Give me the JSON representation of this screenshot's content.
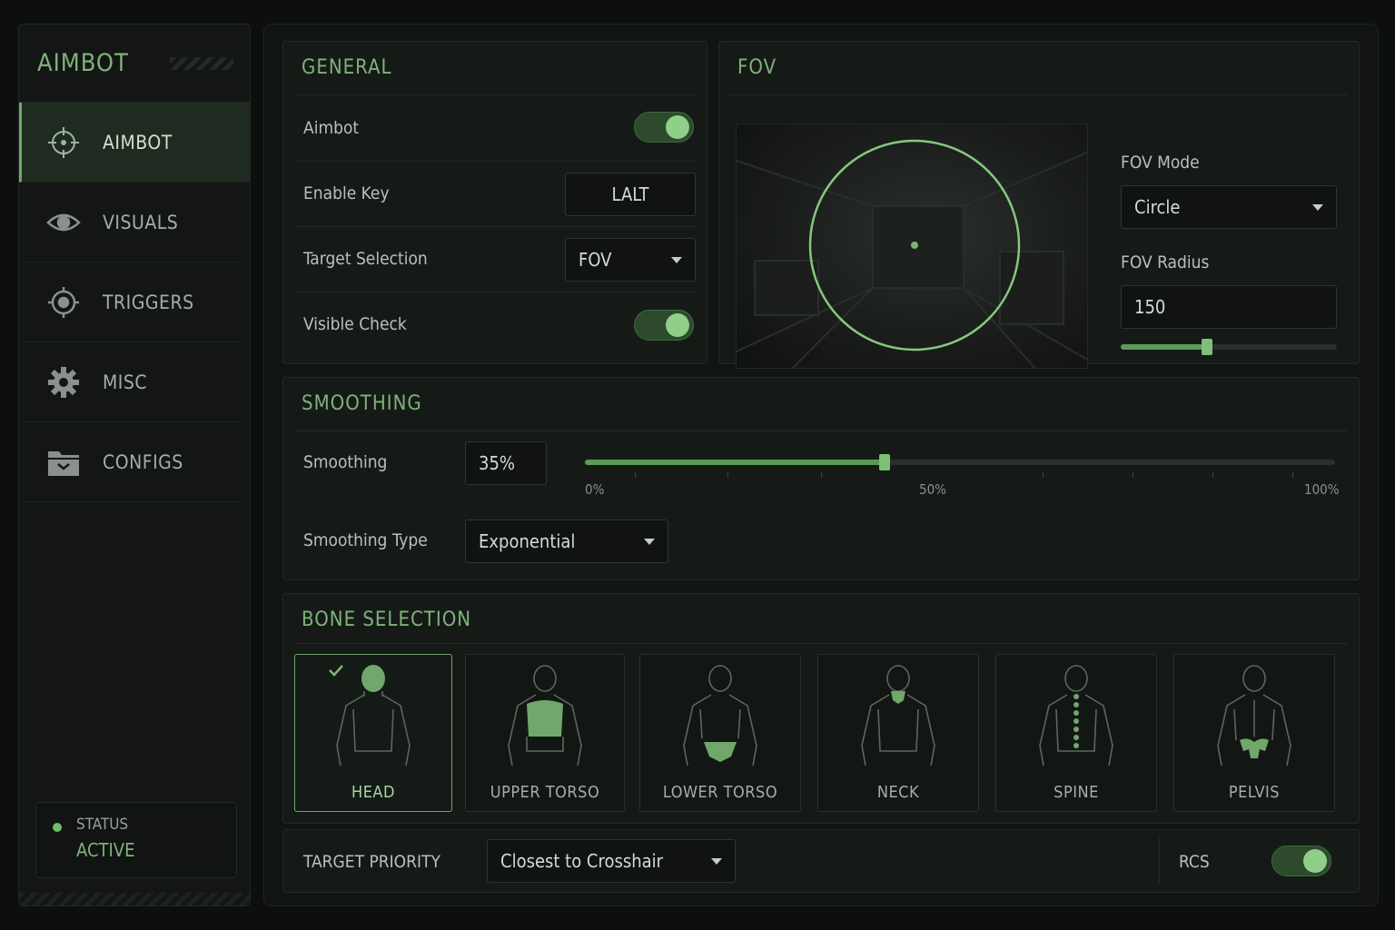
{
  "sidebar": {
    "title": "AIMBOT",
    "items": [
      {
        "label": "AIMBOT",
        "icon": "crosshair-icon",
        "active": true
      },
      {
        "label": "VISUALS",
        "icon": "eye-icon"
      },
      {
        "label": "TRIGGERS",
        "icon": "target-icon"
      },
      {
        "label": "MISC",
        "icon": "gear-icon"
      },
      {
        "label": "CONFIGS",
        "icon": "folder-icon"
      }
    ],
    "status": {
      "label": "STATUS",
      "value": "ACTIVE"
    }
  },
  "general": {
    "title": "GENERAL",
    "aimbot_label": "Aimbot",
    "aimbot_on": true,
    "enable_key_label": "Enable Key",
    "enable_key_value": "LALT",
    "target_selection_label": "Target Selection",
    "target_selection_value": "FOV",
    "visible_check_label": "Visible Check",
    "visible_check_on": true
  },
  "fov": {
    "title": "FOV",
    "mode_label": "FOV Mode",
    "mode_value": "Circle",
    "radius_label": "FOV Radius",
    "radius_value": "150",
    "radius_slider_fraction": 0.4
  },
  "smoothing": {
    "title": "SMOOTHING",
    "smoothing_label": "Smoothing",
    "smoothing_value": "35%",
    "smoothing_fraction": 0.4,
    "scale": [
      "0%",
      "50%",
      "100%"
    ],
    "type_label": "Smoothing Type",
    "type_value": "Exponential"
  },
  "bones": {
    "title": "BONE SELECTION",
    "items": [
      {
        "label": "HEAD",
        "selected": true
      },
      {
        "label": "UPPER TORSO"
      },
      {
        "label": "LOWER TORSO"
      },
      {
        "label": "NECK"
      },
      {
        "label": "SPINE"
      },
      {
        "label": "PELVIS"
      }
    ]
  },
  "bottom": {
    "priority_label": "TARGET PRIORITY",
    "priority_value": "Closest to Crosshair",
    "rcs_label": "RCS",
    "rcs_on": true
  },
  "colors": {
    "accent": "#7fb27a",
    "toggle_on": "#8fcf8a",
    "background": "#0d0f0e"
  }
}
